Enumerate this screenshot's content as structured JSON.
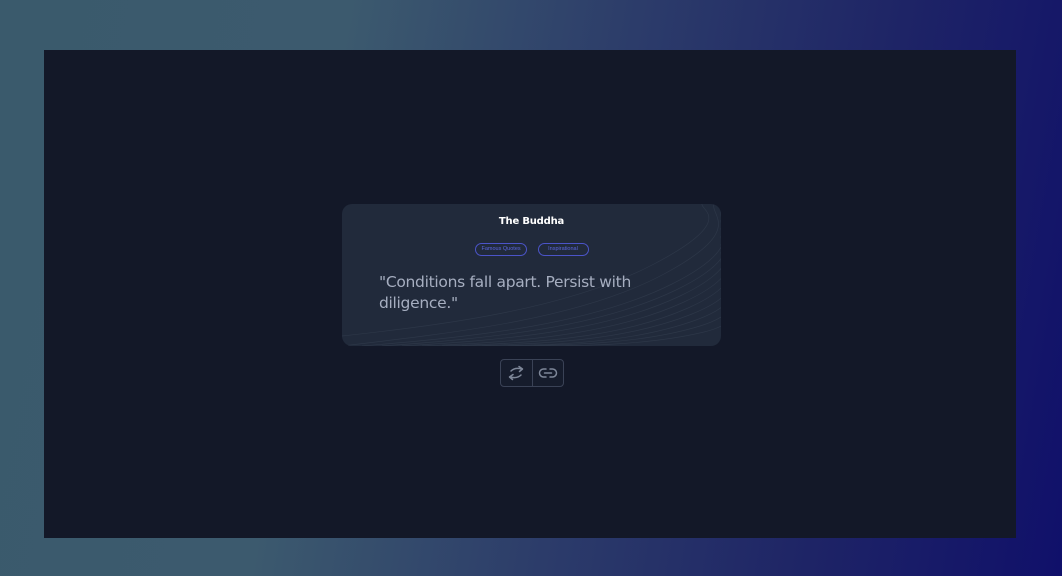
{
  "quote": {
    "author": "The Buddha",
    "tags": [
      "Famous Quotes",
      "Inspirational"
    ],
    "text": "\"Conditions fall apart. Persist with diligence.\""
  },
  "actions": {
    "icons": [
      "swap-arrows-icon",
      "link-icon"
    ]
  },
  "colors": {
    "page_gradient_start": "#3a5a6c",
    "page_gradient_end": "#10106a",
    "app_background": "#131828",
    "card_background": "#212a3b",
    "tag_accent": "#5b66de",
    "quote_text": "#a6aec0"
  }
}
